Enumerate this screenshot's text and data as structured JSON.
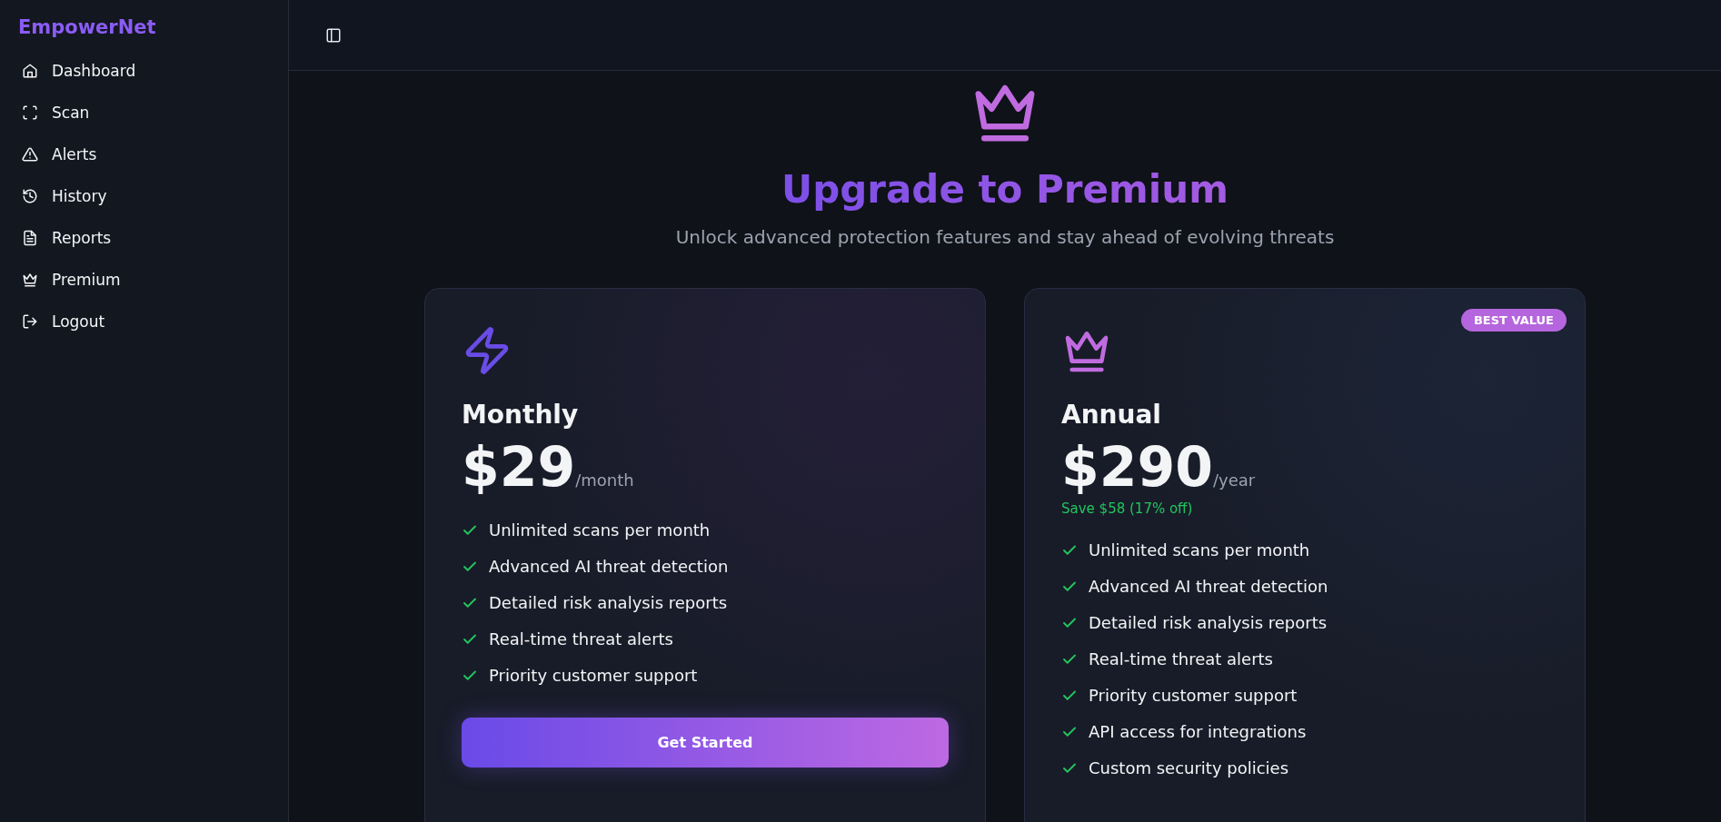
{
  "sidebar": {
    "logo": "EmpowerNet",
    "items": [
      {
        "label": "Dashboard"
      },
      {
        "label": "Scan"
      },
      {
        "label": "Alerts"
      },
      {
        "label": "History"
      },
      {
        "label": "Reports"
      },
      {
        "label": "Premium"
      },
      {
        "label": "Logout"
      }
    ]
  },
  "hero": {
    "title": "Upgrade to Premium",
    "subtitle": "Unlock advanced protection features and stay ahead of evolving threats"
  },
  "plans": [
    {
      "name": "Monthly",
      "price": "$29",
      "period": "/month",
      "features": [
        "Unlimited scans per month",
        "Advanced AI threat detection",
        "Detailed risk analysis reports",
        "Real-time threat alerts",
        "Priority customer support"
      ],
      "button": "Get Started"
    },
    {
      "name": "Annual",
      "badge": "BEST VALUE",
      "price": "$290",
      "period": "/year",
      "savings": "Save $58 (17% off)",
      "features": [
        "Unlimited scans per month",
        "Advanced AI threat detection",
        "Detailed risk analysis reports",
        "Real-time threat alerts",
        "Priority customer support",
        "API access for integrations",
        "Custom security policies"
      ]
    }
  ]
}
